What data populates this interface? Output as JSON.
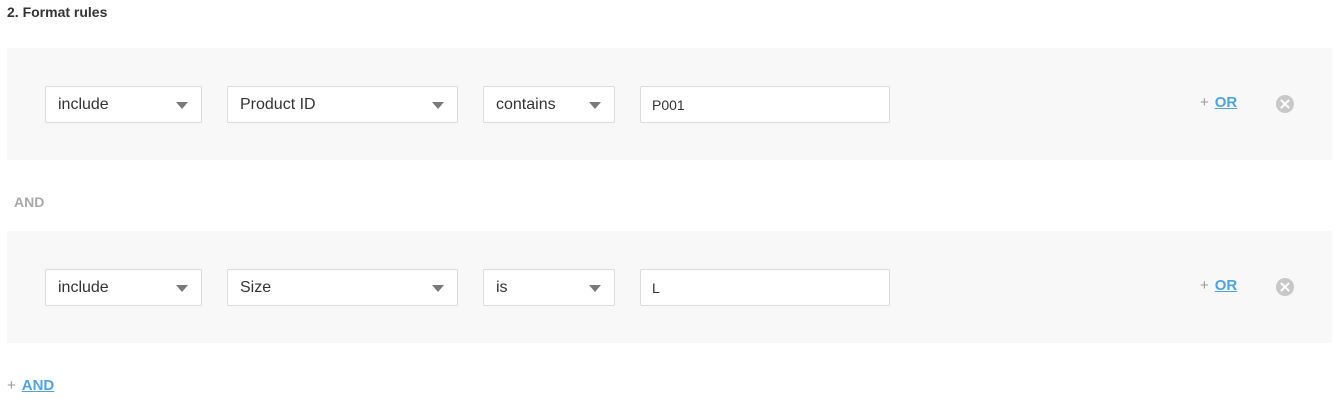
{
  "section": {
    "title": "2. Format rules"
  },
  "rules": [
    {
      "mode": "include",
      "field": "Product ID",
      "operator": "contains",
      "value": "P001",
      "or_plus": "+",
      "or_label": "OR"
    },
    {
      "mode": "include",
      "field": "Size",
      "operator": "is",
      "value": "L",
      "or_plus": "+",
      "or_label": "OR"
    }
  ],
  "connector": {
    "and_label": "AND"
  },
  "footer": {
    "add_plus": "+",
    "add_and_label": "AND"
  },
  "icons": {
    "dropdown": "caret-down-icon",
    "remove": "close-circle-icon"
  },
  "colors": {
    "link": "#4fa3e0",
    "row_background": "#f8f8f8",
    "muted": "#a8a8a8"
  }
}
